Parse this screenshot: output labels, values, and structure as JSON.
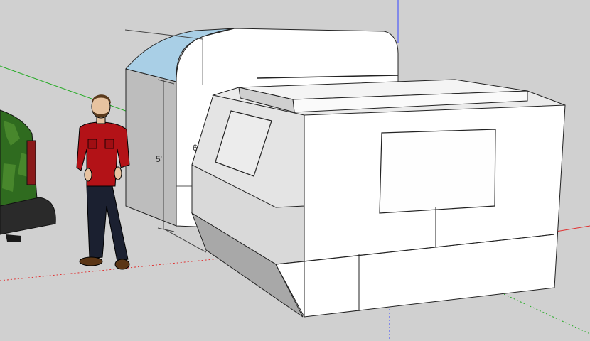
{
  "scene": {
    "background_color": "#d0d0d0",
    "axis_colors": {
      "red": "#e03030",
      "green": "#22aa22",
      "blue": "#3344ff"
    }
  },
  "dimensions": {
    "height_label": "5'",
    "width_label": "6'"
  },
  "figure": {
    "shirt_color": "#b31217",
    "pants_color": "#1b2030"
  },
  "vehicle": {
    "camo_color": "#2f6b1f",
    "roof_tint_color": "#a9cfe6"
  }
}
